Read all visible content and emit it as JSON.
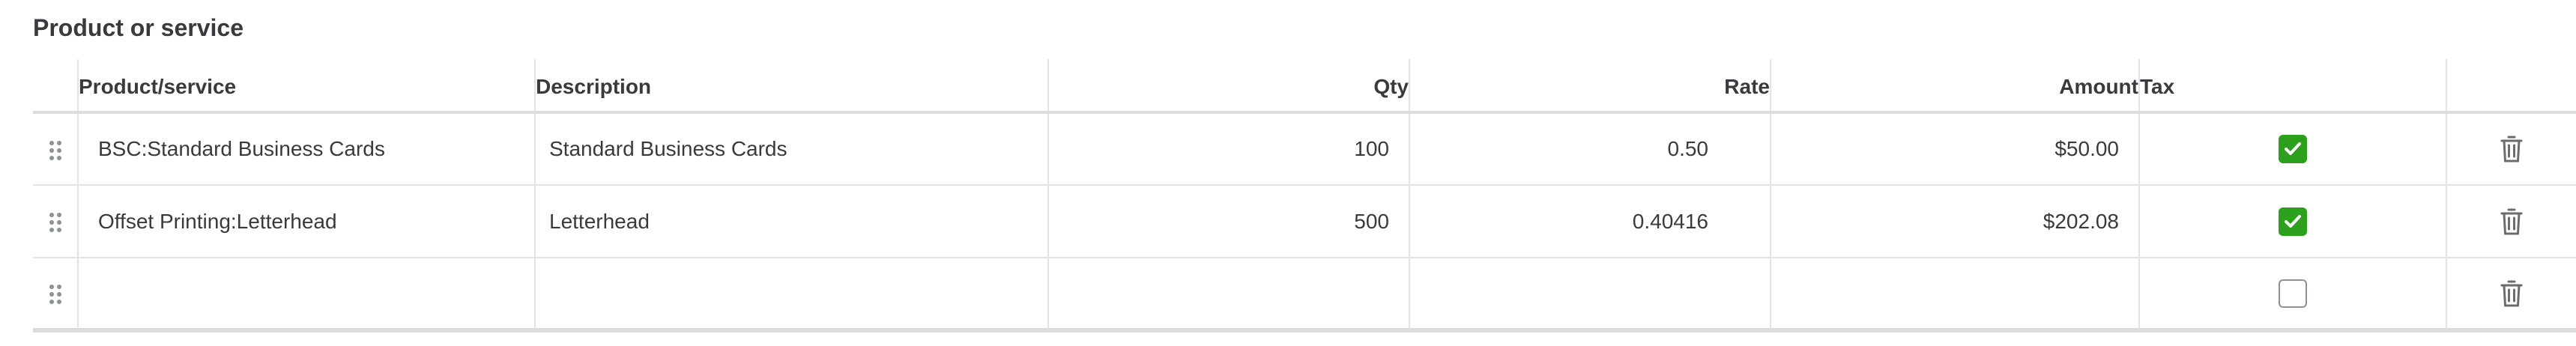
{
  "section": {
    "title": "Product or service"
  },
  "columns": {
    "drag": "",
    "product": "Product/service",
    "description": "Description",
    "qty": "Qty",
    "rate": "Rate",
    "amount": "Amount",
    "tax": "Tax",
    "actions": ""
  },
  "rows": [
    {
      "product": "BSC:Standard Business Cards",
      "description": "Standard Business Cards",
      "qty": "100",
      "rate": "0.50",
      "amount": "$50.00",
      "tax_checked": true
    },
    {
      "product": "Offset Printing:Letterhead",
      "description": "Letterhead",
      "qty": "500",
      "rate": "0.40416",
      "amount": "$202.08",
      "tax_checked": true
    },
    {
      "product": "",
      "description": "",
      "qty": "",
      "rate": "",
      "amount": "",
      "tax_checked": false
    }
  ],
  "icons": {
    "drag": "drag-handle-icon",
    "checkmark": "checkmark-icon",
    "delete": "trash-icon"
  },
  "colors": {
    "check_green": "#2ca01c",
    "text": "#393a3d",
    "border": "#e4e4e6",
    "icon_gray": "#6b6c72"
  }
}
